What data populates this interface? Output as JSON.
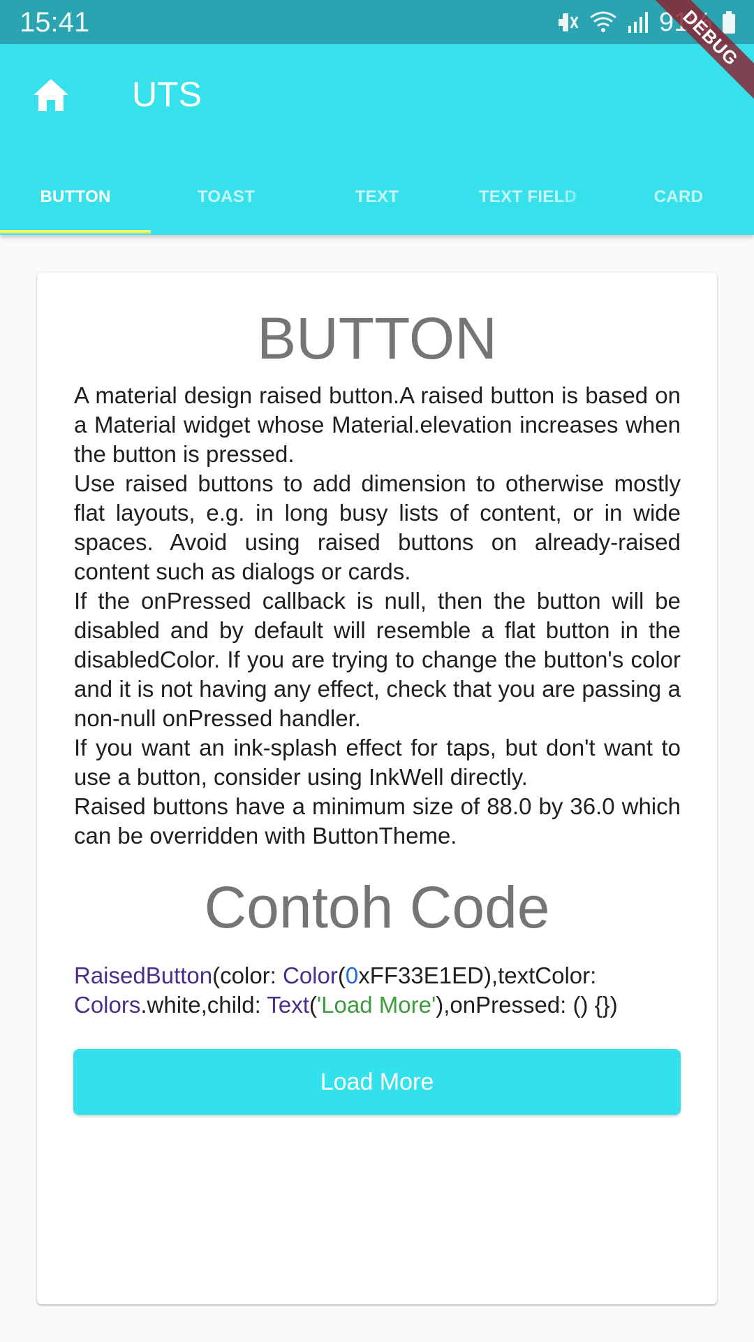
{
  "status_bar": {
    "time": "15:41",
    "battery": "91%",
    "icons": [
      "mute-icon",
      "wifi-icon",
      "signal-icon",
      "battery-icon"
    ]
  },
  "debug_banner": "DEBUG",
  "app_bar": {
    "icon": "home-icon",
    "title": "UTS"
  },
  "tabs": [
    {
      "label": "BUTTON",
      "active": true
    },
    {
      "label": "TOAST",
      "active": false
    },
    {
      "label": "TEXT",
      "active": false
    },
    {
      "label": "TEXT FIELD",
      "active": false
    },
    {
      "label": "CARD",
      "active": false
    }
  ],
  "card": {
    "title": "BUTTON",
    "paragraphs": [
      "A material design raised button.A raised button is based on a Material widget whose Material.elevation increases when the button is pressed.",
      "Use raised buttons to add dimension to otherwise mostly flat layouts, e.g. in long busy lists of content, or in wide spaces. Avoid using raised buttons on already-raised content such as dialogs or cards.",
      "If the onPressed callback is null, then the button will be disabled and by default will resemble a flat button in the disabledColor. If you are trying to change the button's color and it is not having any effect, check that you are passing a non-null onPressed handler.",
      "If you want an ink-splash effect for taps, but don't want to use a button, consider using InkWell directly.",
      "Raised buttons have a minimum size of 88.0 by 36.0 which can be overridden with ButtonTheme."
    ],
    "code_title": "Contoh Code",
    "code": {
      "c1": "RaisedButton",
      "t1": "(color: ",
      "c2": "Color",
      "t2": "(",
      "n1": "0",
      "t3": "xFF33E1ED),textColor: ",
      "c3": "Colors",
      "t4": ".white,child: ",
      "c4": "Text",
      "t5": "(",
      "s1": "'Load More'",
      "t6": "),onPressed: () {})"
    },
    "button_label": "Load More"
  },
  "colors": {
    "status_bar": "#2aa4b0",
    "app_bar": "#36e1eb",
    "tab_indicator": "#f0f56a",
    "button": "#33e1ed",
    "code_class": "#4a2f8a",
    "code_number": "#1f6fd0",
    "code_string": "#3d9a3d"
  }
}
